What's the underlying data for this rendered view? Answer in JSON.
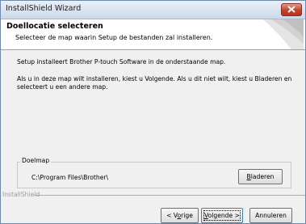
{
  "window": {
    "title": "InstallShield Wizard"
  },
  "header": {
    "title": "Doellocatie selecteren",
    "subtitle": "Selecteer de map waarin Setup de bestanden zal installeren."
  },
  "body": {
    "line1": "Setup installeert Brother P-touch Software in de onderstaande map.",
    "line2": "Als u in deze map wilt installeren, kiest u Volgende. Als u dit niet wilt, kiest u Bladeren en selecteert u een andere map."
  },
  "destination": {
    "group_label": "Doelmap",
    "path": "C:\\Program Files\\Brother\\",
    "browse_label_pre": "",
    "browse_label_key": "B",
    "browse_label_post": "laderen"
  },
  "footer": {
    "brand": "InstallShield",
    "back_pre": "< V",
    "back_key": "o",
    "back_post": "rige",
    "next_pre": "",
    "next_key": "V",
    "next_post": "olgende >",
    "cancel_label": "Annuleren"
  },
  "colors": {
    "close_button": "#c4412e",
    "window_bg": "#f0f0f0",
    "header_bg": "#ffffff"
  },
  "icons": [
    "close-icon",
    "wizard-header-graphic"
  ]
}
